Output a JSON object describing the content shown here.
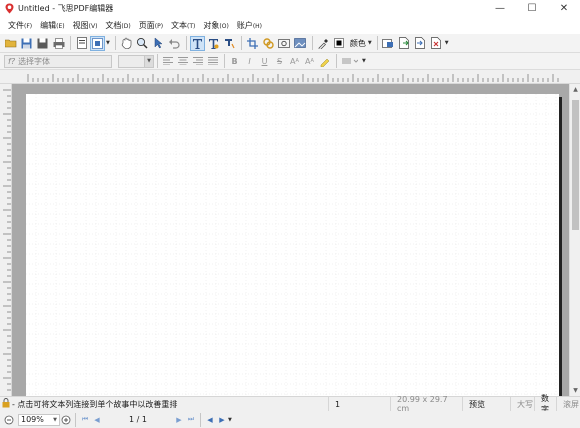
{
  "window": {
    "title": "Untitled - 飞思PDF编辑器",
    "minimize": "—",
    "maximize": "☐",
    "close": "✕"
  },
  "menu": [
    {
      "label": "文件",
      "acc": "(F)"
    },
    {
      "label": "编辑",
      "acc": "(E)"
    },
    {
      "label": "视图",
      "acc": "(V)"
    },
    {
      "label": "文档",
      "acc": "(D)"
    },
    {
      "label": "页面",
      "acc": "(P)"
    },
    {
      "label": "文本",
      "acc": "(T)"
    },
    {
      "label": "对象",
      "acc": "(O)"
    },
    {
      "label": "账户",
      "acc": "(H)"
    }
  ],
  "toolbar": {
    "color_label": "颜色",
    "icons": [
      "open-icon",
      "save-icon",
      "save-as-icon",
      "print-icon",
      "export-icon",
      "import-icon",
      "hand-icon",
      "zoom-icon",
      "select-icon",
      "undo-icon",
      "text-tool-icon",
      "text-edit-icon",
      "text-path-icon",
      "crop-icon",
      "link-icon",
      "image-icon",
      "shape-icon",
      "eyedropper-icon",
      "color-swatch-icon",
      "page-add-icon",
      "page-insert-icon",
      "page-extract-icon",
      "page-delete-icon"
    ]
  },
  "format_bar": {
    "font_placeholder": "选择字体",
    "font_icon": "f?"
  },
  "status": {
    "message": "- 点击可将文本列连接到单个故事中以改善重排",
    "page_number": "1",
    "page_size": "20.99 x 29.7 cm",
    "mode": "预览",
    "caps": "大写",
    "num": "数字",
    "scroll": "滚屏"
  },
  "nav": {
    "zoom": "109%",
    "page_indicator": "1 / 1"
  },
  "colors": {
    "accent": "#2f6fc4",
    "page_shadow": "#222222"
  }
}
